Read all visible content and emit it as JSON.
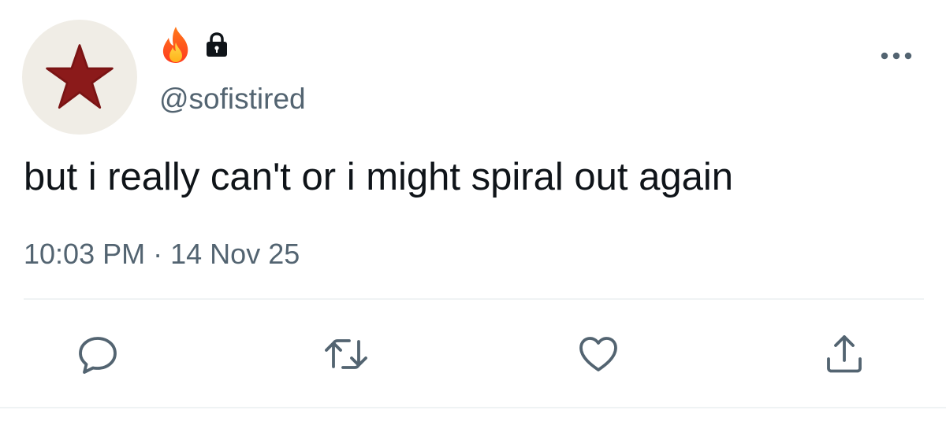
{
  "tweet": {
    "handle": "@sofistired",
    "display_name_icons": [
      "fire-icon",
      "lock-icon"
    ],
    "text": "but i really can't or i might spiral out again",
    "time": "10:03 PM",
    "separator": "·",
    "date": "14 Nov 25",
    "avatar_icon": "red-star-icon"
  },
  "actions": {
    "reply_icon": "reply-icon",
    "retweet_icon": "retweet-icon",
    "like_icon": "heart-icon",
    "share_icon": "share-icon",
    "more_icon": "more-dots-icon"
  },
  "colors": {
    "text": "#0f1419",
    "secondary": "#536471",
    "icon": "#536471",
    "star": "#8b1a1a",
    "avatar_bg": "#f0ede6",
    "divider": "#eff3f4"
  }
}
